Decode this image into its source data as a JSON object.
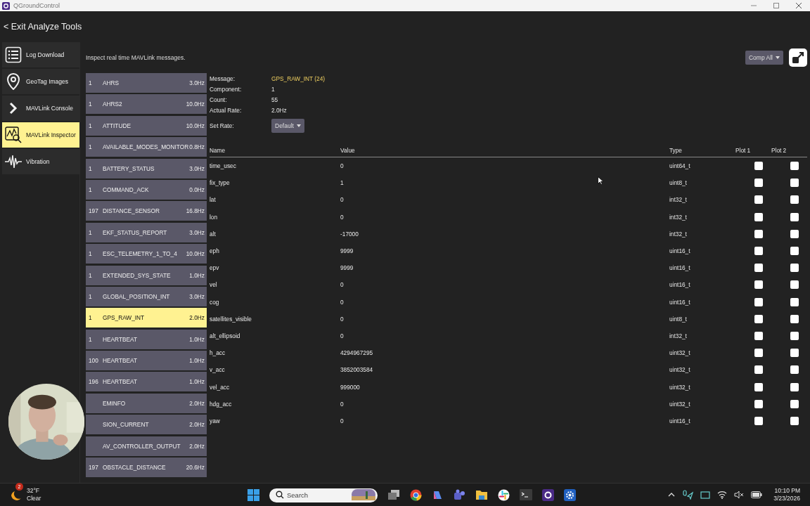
{
  "window": {
    "title": "QGroundControl"
  },
  "header": {
    "back_label": "< Exit Analyze Tools"
  },
  "nav": [
    {
      "label": "Log Download",
      "selected": false
    },
    {
      "label": "GeoTag Images",
      "selected": false
    },
    {
      "label": "MAVLink Console",
      "selected": false
    },
    {
      "label": "MAVLink Inspector",
      "selected": true
    },
    {
      "label": "Vibration",
      "selected": false
    }
  ],
  "description": "Inspect real time MAVLink messages.",
  "comp_filter": {
    "label": "Comp All"
  },
  "messages": [
    {
      "component": "1",
      "name": "AHRS",
      "rate": "3.0Hz",
      "selected": false
    },
    {
      "component": "1",
      "name": "AHRS2",
      "rate": "10.0Hz",
      "selected": false
    },
    {
      "component": "1",
      "name": "ATTITUDE",
      "rate": "10.0Hz",
      "selected": false
    },
    {
      "component": "1",
      "name": "AVAILABLE_MODES_MONITOR",
      "rate": "0.8Hz",
      "selected": false
    },
    {
      "component": "1",
      "name": "BATTERY_STATUS",
      "rate": "3.0Hz",
      "selected": false
    },
    {
      "component": "1",
      "name": "COMMAND_ACK",
      "rate": "0.0Hz",
      "selected": false
    },
    {
      "component": "197",
      "name": "DISTANCE_SENSOR",
      "rate": "16.8Hz",
      "selected": false
    },
    {
      "component": "1",
      "name": "EKF_STATUS_REPORT",
      "rate": "3.0Hz",
      "selected": false
    },
    {
      "component": "1",
      "name": "ESC_TELEMETRY_1_TO_4",
      "rate": "10.0Hz",
      "selected": false
    },
    {
      "component": "1",
      "name": "EXTENDED_SYS_STATE",
      "rate": "1.0Hz",
      "selected": false
    },
    {
      "component": "1",
      "name": "GLOBAL_POSITION_INT",
      "rate": "3.0Hz",
      "selected": false
    },
    {
      "component": "1",
      "name": "GPS_RAW_INT",
      "rate": "2.0Hz",
      "selected": true
    },
    {
      "component": "1",
      "name": "HEARTBEAT",
      "rate": "1.0Hz",
      "selected": false
    },
    {
      "component": "100",
      "name": "HEARTBEAT",
      "rate": "1.0Hz",
      "selected": false
    },
    {
      "component": "196",
      "name": "HEARTBEAT",
      "rate": "1.0Hz",
      "selected": false
    },
    {
      "name": "EMINFO",
      "rate": "2.0Hz",
      "selected": false
    },
    {
      "name": "SION_CURRENT",
      "rate": "2.0Hz",
      "selected": false
    },
    {
      "name": "AV_CONTROLLER_OUTPUT",
      "rate": "2.0Hz",
      "selected": false
    },
    {
      "component": "197",
      "name": "OBSTACLE_DISTANCE",
      "rate": "20.6Hz",
      "selected": false
    }
  ],
  "detail": {
    "info": [
      {
        "label": "Message:",
        "value": "GPS_RAW_INT (24)",
        "kind": "highlight"
      },
      {
        "label": "Component:",
        "value": "1",
        "kind": "plain"
      },
      {
        "label": "Count:",
        "value": "55",
        "kind": "plain"
      },
      {
        "label": "Actual Rate:",
        "value": "2.0Hz",
        "kind": "plain"
      }
    ],
    "set_rate": {
      "label": "Set Rate:",
      "value": "Default"
    },
    "columns": [
      "Name",
      "Value",
      "Type",
      "Plot 1",
      "Plot 2"
    ],
    "fields": [
      {
        "name": "time_usec",
        "value": "0",
        "type": "uint64_t",
        "plot1": false,
        "plot2": false
      },
      {
        "name": "fix_type",
        "value": "1",
        "type": "uint8_t",
        "plot1": false,
        "plot2": false
      },
      {
        "name": "lat",
        "value": "0",
        "type": "int32_t",
        "plot1": false,
        "plot2": false
      },
      {
        "name": "lon",
        "value": "0",
        "type": "int32_t",
        "plot1": false,
        "plot2": false
      },
      {
        "name": "alt",
        "value": "-17000",
        "type": "int32_t",
        "plot1": false,
        "plot2": false
      },
      {
        "name": "eph",
        "value": "9999",
        "type": "uint16_t",
        "plot1": false,
        "plot2": false
      },
      {
        "name": "epv",
        "value": "9999",
        "type": "uint16_t",
        "plot1": false,
        "plot2": false
      },
      {
        "name": "vel",
        "value": "0",
        "type": "uint16_t",
        "plot1": false,
        "plot2": false
      },
      {
        "name": "cog",
        "value": "0",
        "type": "uint16_t",
        "plot1": false,
        "plot2": false
      },
      {
        "name": "satellites_visible",
        "value": "0",
        "type": "uint8_t",
        "plot1": false,
        "plot2": false
      },
      {
        "name": "alt_ellipsoid",
        "value": "0",
        "type": "int32_t",
        "plot1": false,
        "plot2": false
      },
      {
        "name": "h_acc",
        "value": "4294967295",
        "type": "uint32_t",
        "plot1": false,
        "plot2": false
      },
      {
        "name": "v_acc",
        "value": "3852003584",
        "type": "uint32_t",
        "plot1": false,
        "plot2": false
      },
      {
        "name": "vel_acc",
        "value": "999000",
        "type": "uint32_t",
        "plot1": false,
        "plot2": false
      },
      {
        "name": "hdg_acc",
        "value": "0",
        "type": "uint32_t",
        "plot1": false,
        "plot2": false
      },
      {
        "name": "yaw",
        "value": "0",
        "type": "uint16_t",
        "plot1": false,
        "plot2": false
      }
    ]
  },
  "taskbar": {
    "weather": {
      "badge": "2",
      "temperature": "32°F",
      "condition": "Clear"
    },
    "search": {
      "placeholder": "Search"
    },
    "clock": {
      "time": "10:10 PM",
      "date": "3/23/2026"
    }
  }
}
